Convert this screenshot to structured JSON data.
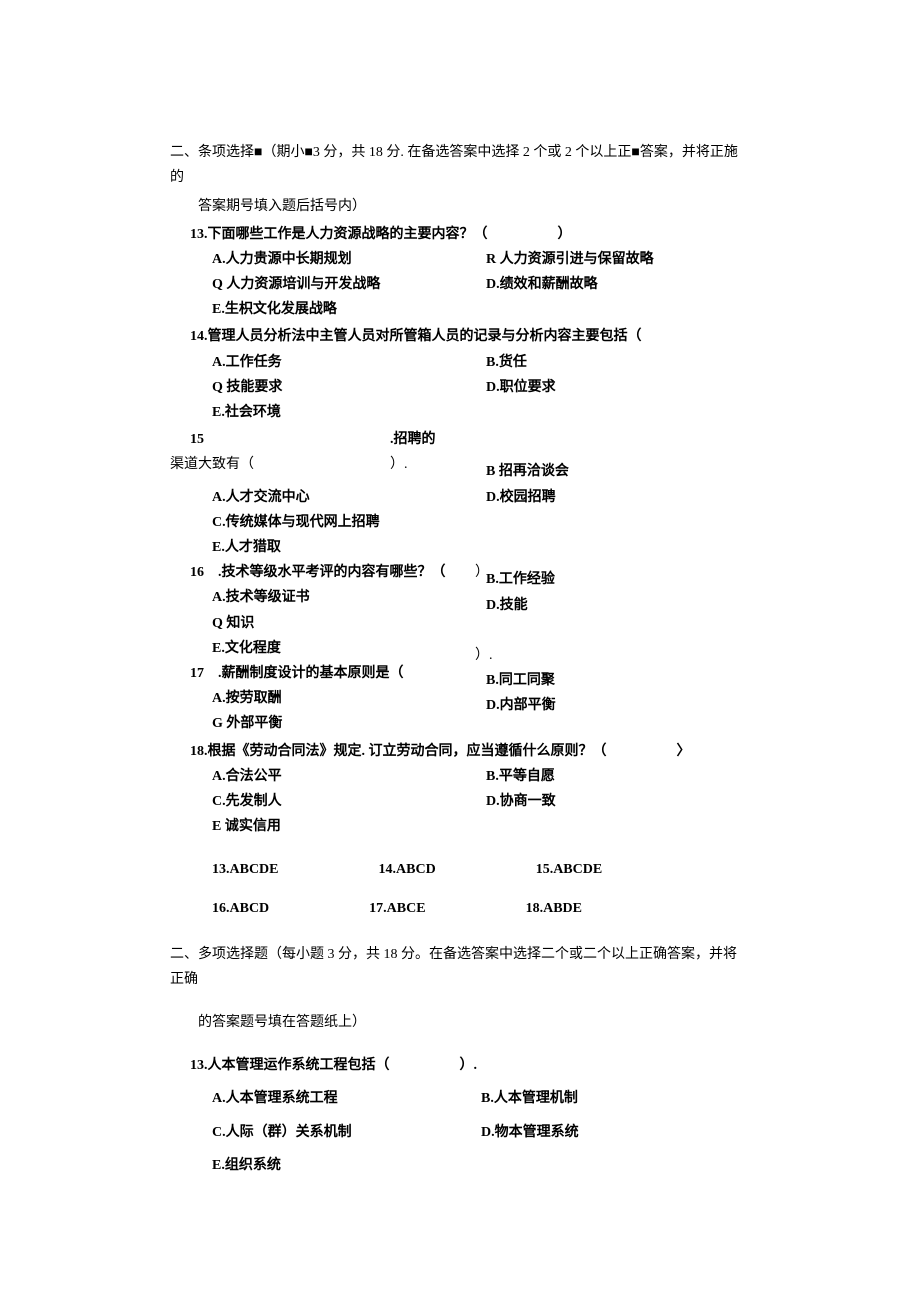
{
  "section1": {
    "heading": "二、条项选择■（期小■3 分，共 18 分. 在备选答案中选择 2 个或 2 个以上正■答案，并将正施的",
    "heading_cont": "答案期号填入题后括号内）",
    "q13": {
      "stem": "13.下面哪些工作是人力资源战略的主要内容？（　　　　　）",
      "A": "A.人力贵源中长期规划",
      "R": "R 人力资源引进与保留故略",
      "Q": "Q 人力资源培训与开发战略",
      "D": "D.绩效和薪酬故略",
      "E": "E.生枳文化发展战略"
    },
    "q14": {
      "stem": "14.管理人员分析法中主管人员对所管箱人员的记录与分析内容主要包括（",
      "A": "A.工作任务",
      "B": "B.货任",
      "Q": "Q 技能要求",
      "D": "D.职位要求",
      "E": "E.社会环境"
    },
    "q15": {
      "num": "15",
      "stem_right": ".招聘的",
      "stem_line2_left": "渠道大致有（",
      "stem_line2_right": "）.",
      "A": "A.人才交流中心",
      "B": "B 招再洽谈会",
      "C": "C.传统媒体与现代网上招聘",
      "D": "D.校园招聘",
      "E": "E.人才猎取"
    },
    "q16": {
      "stem": "16　.技术等级水平考评的内容有哪些？（",
      "paren": "）",
      "A": "A.技术等级证书",
      "B": "B.工作经验",
      "Q": "Q 知识",
      "D": "D.技能",
      "E": "E.文化程度"
    },
    "q17": {
      "stem": "17　.薪酬制度设计的基本原则是（",
      "paren": "）.",
      "A": "A.按劳取酬",
      "B": "B.同工同聚",
      "G": "G 外部平衡",
      "D": "D.内部平衡"
    },
    "q18": {
      "stem": "18.根据《劳动合同法》规定. 订立劳动合同，应当遵循什么原则？（　　　　　〉",
      "A": "A.合法公平",
      "B": "B.平等自愿",
      "C": "C.先发制人",
      "D": "D.协商一致",
      "E": "E 诚实信用"
    },
    "answers": {
      "a13": "13.ABCDE",
      "a14": "14.ABCD",
      "a15": "15.ABCDE",
      "a16": "16.ABCD",
      "a17": "17.ABCE",
      "a18": "18.ABDE"
    }
  },
  "section2": {
    "heading": "二、多项选择题（每小题 3 分，共 18 分。在备选答案中选择二个或二个以上正确答案，并将正确",
    "heading_cont": "的答案题号填在答题纸上）",
    "q13": {
      "stem": "13.人本管理运作系统工程包括（　　　　　）.",
      "A": "A.人本管理系统工程",
      "B": "B.人本管理机制",
      "C": "C.人际（群）关系机制",
      "D": "D.物本管理系统",
      "E": "E.组织系统"
    }
  }
}
